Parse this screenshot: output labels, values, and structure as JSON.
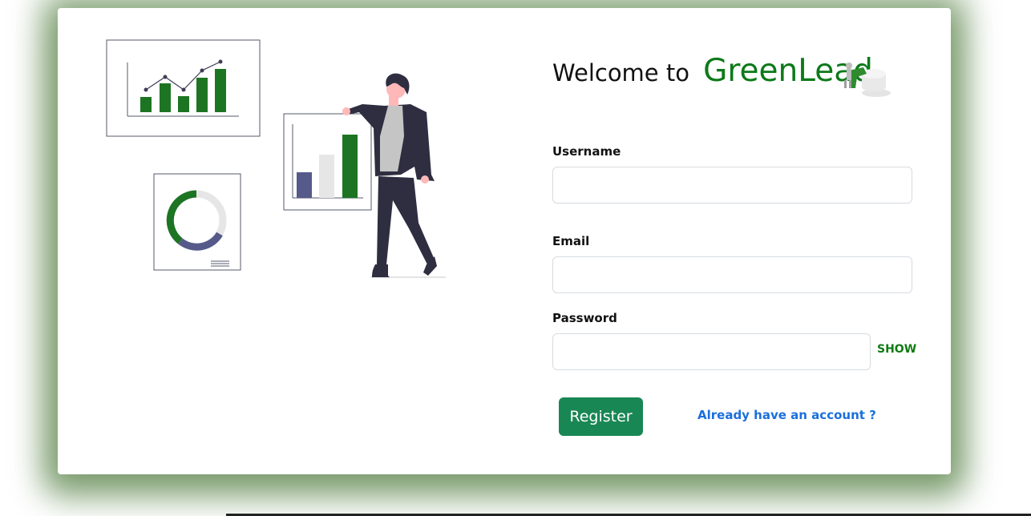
{
  "header": {
    "welcome_text": "Welcome to",
    "brand_name": "GreenLead",
    "logo_icon": "people-puzzle-logo-icon"
  },
  "form": {
    "username_label": "Username",
    "username_value": "",
    "email_label": "Email",
    "email_value": "",
    "password_label": "Password",
    "password_value": "",
    "show_password_label": "SHOW",
    "register_label": "Register",
    "login_link_label": "Already have an account ?"
  },
  "illustration": {
    "icon": "business-analytics-illustration"
  },
  "colors": {
    "brand_green": "#0d7a1a",
    "button_green": "#198754",
    "link_blue": "#1a6fdc",
    "chart_purple": "#565a8a",
    "shadow_green": "#3c6e28"
  }
}
